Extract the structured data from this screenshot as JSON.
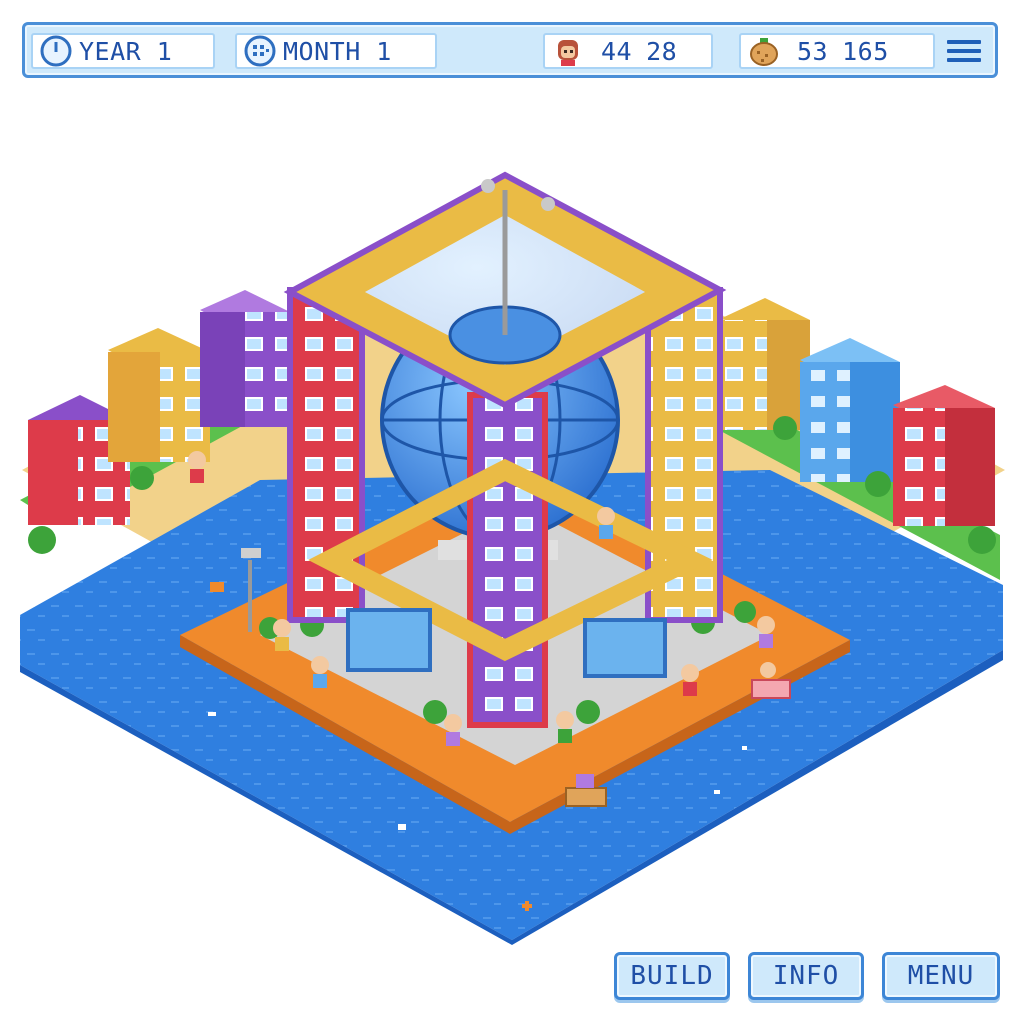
{
  "hud": {
    "year_label": "YEAR 1",
    "month_label": "MONTH 1",
    "population_value_1": "44",
    "population_value_2": "28",
    "food_value_1": "53",
    "food_value_2": "165",
    "icons": {
      "year": "clock-icon",
      "month": "calendar-icon",
      "population": "citizen-face-icon",
      "food": "fruit-basket-icon",
      "menu": "hamburger-menu-icon"
    }
  },
  "buttons": {
    "build": "BUILD",
    "info": "INFO",
    "menu": "MENU"
  },
  "colors": {
    "hud_bg": "#cfe9fb",
    "hud_border": "#4a8fd8",
    "text": "#1f4fa6",
    "water": "#2f7fe0",
    "plaza": "#f08a2c",
    "tower_red": "#dd3b4a",
    "tower_yellow": "#eabb45",
    "tower_purple": "#8a4fc9",
    "globe": "#4a90e2"
  }
}
